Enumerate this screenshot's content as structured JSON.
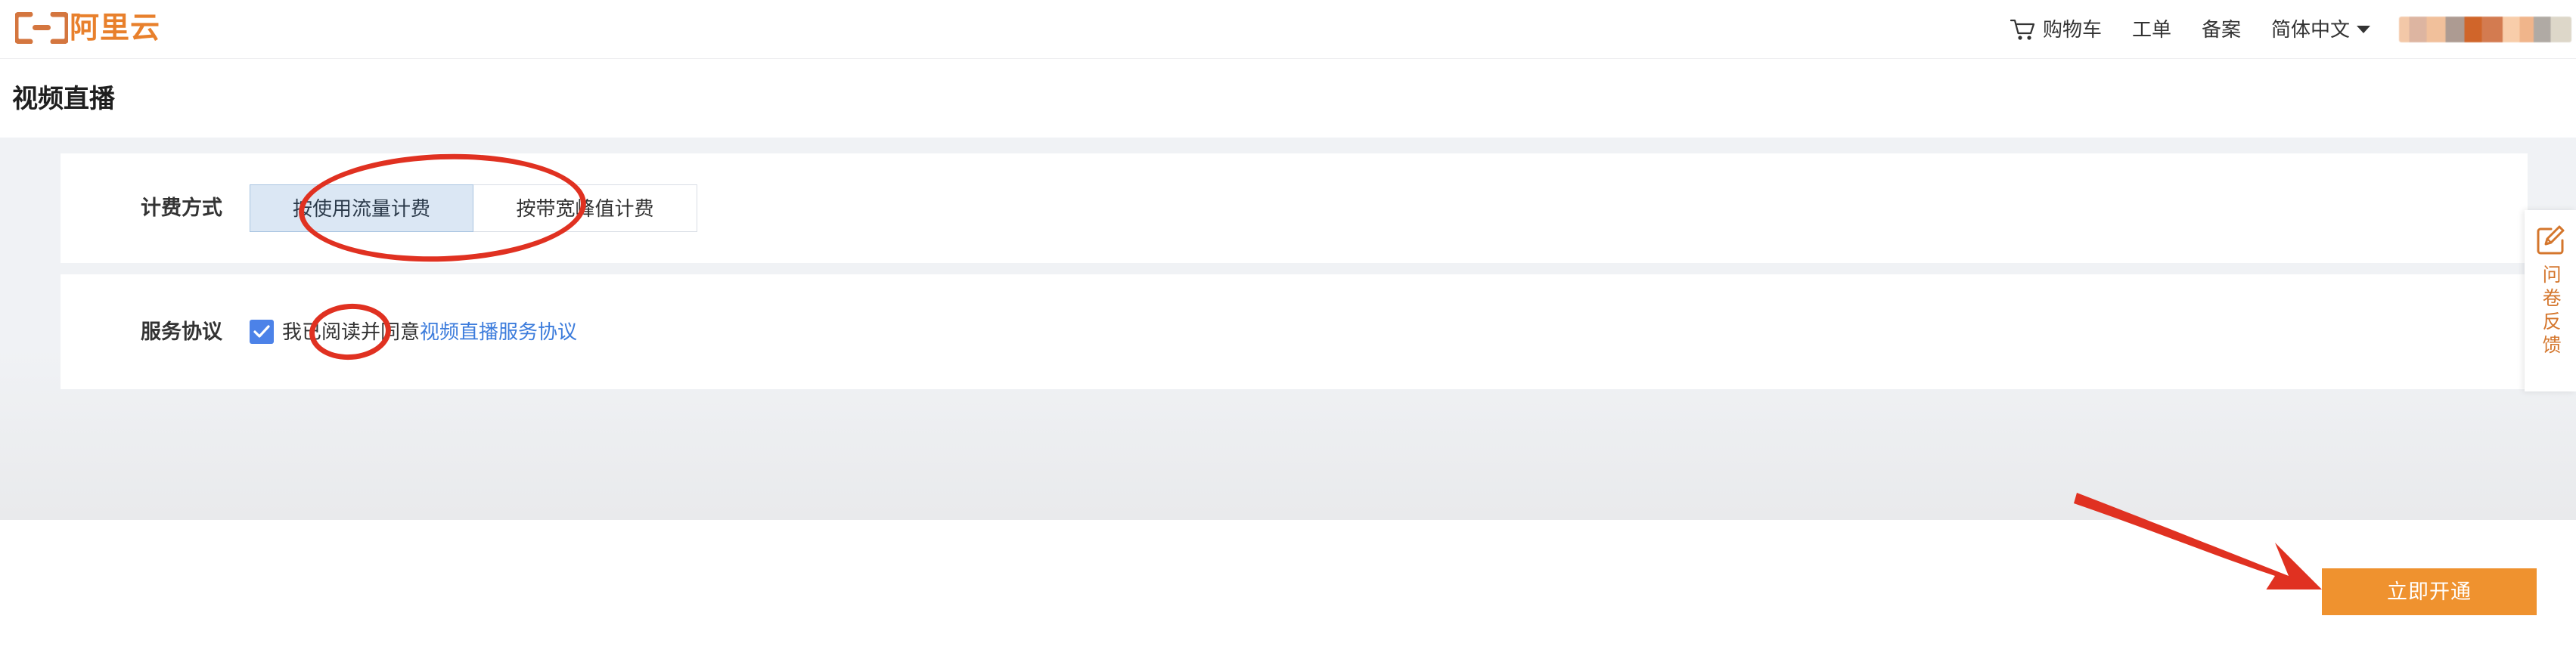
{
  "header": {
    "logo": {
      "icon": "aliyun-bracket-logo",
      "text": "阿里云"
    },
    "nav": [
      {
        "id": "cart",
        "icon": "shopping-cart-icon",
        "label": "购物车"
      },
      {
        "id": "ticket",
        "icon": null,
        "label": "工单"
      },
      {
        "id": "icp",
        "icon": null,
        "label": "备案"
      },
      {
        "id": "language",
        "icon": "chevron-down-icon",
        "label": "简体中文"
      }
    ],
    "user_account": {
      "redacted": true,
      "label": ""
    }
  },
  "page": {
    "title": "视频直播"
  },
  "form": {
    "billing": {
      "label": "计费方式",
      "options": [
        {
          "label": "按使用流量计费",
          "selected": true
        },
        {
          "label": "按带宽峰值计费",
          "selected": false
        }
      ]
    },
    "agreement": {
      "label": "服务协议",
      "checked": true,
      "text": "我已阅读并同意",
      "link_text": "视频直播服务协议"
    }
  },
  "feedback_widget": {
    "icon": "pencil-edit-icon",
    "label": "问卷反馈"
  },
  "footer": {
    "submit_label": "立即开通"
  },
  "annotations": {
    "color": "#e03121",
    "ellipse_billing_tab": "按使用流量计费",
    "ellipse_agreement_checkbox": "agreement-checkbox",
    "arrow_target": "立即开通"
  },
  "colors": {
    "brand_orange": "#e8802c",
    "submit_orange": "#ef922f",
    "link_blue": "#3c7cdc",
    "checkbox_blue": "#4c82e8",
    "selected_tab_bg": "#dbe7f4",
    "page_bg": "#f0f2f5",
    "annotation_red": "#e03121",
    "feedback_orange": "#d4762c"
  }
}
